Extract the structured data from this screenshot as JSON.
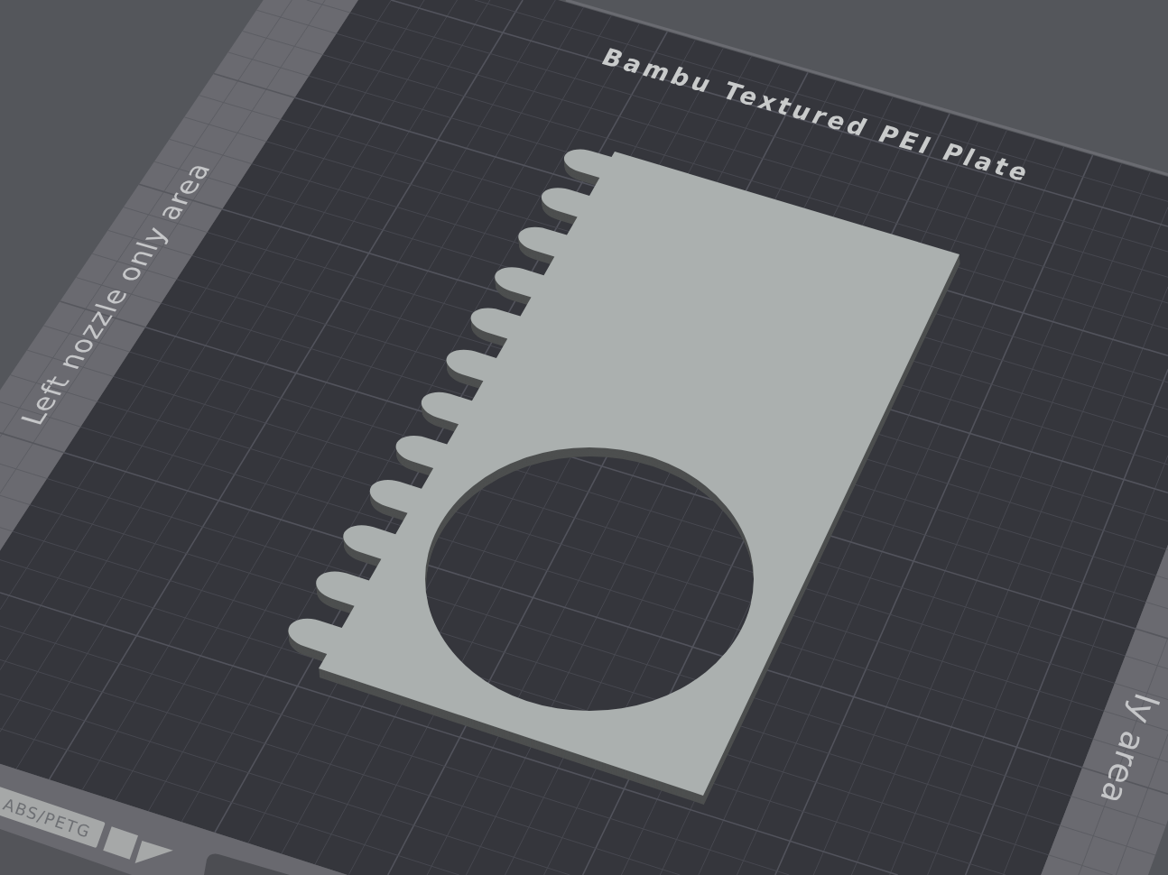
{
  "viewport": {
    "plate": {
      "name": "Bambu Textured PEI Plate",
      "zones": [
        {
          "kind": "left",
          "label": "Left nozzle only area"
        },
        {
          "kind": "right",
          "label": "ly area"
        }
      ],
      "material_tag": "ABS/PETG"
    }
  }
}
